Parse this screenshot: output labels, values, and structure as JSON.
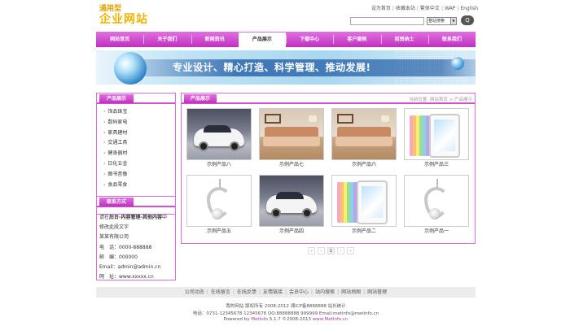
{
  "logo": {
    "line1": "通用型",
    "line2": "企业网站"
  },
  "toplinks": [
    "设为首页",
    "收藏本站",
    "繁体中文",
    "WAP",
    "English"
  ],
  "search": {
    "value": "",
    "select": "整站搜索",
    "button": "Q"
  },
  "nav": [
    "网站首页",
    "关于我们",
    "新闻资讯",
    "产品展示",
    "下载中心",
    "客户案例",
    "招贤纳士",
    "联系我们"
  ],
  "nav_active": "产品展示",
  "banner": {
    "slogan": "专业设计、精心打造、科学管理、推动发展!"
  },
  "sidebar": {
    "categories_title": "产品展示",
    "categories": [
      "饰品珠宝",
      "数码家电",
      "家具建材",
      "交通工具",
      "健身器材",
      "日化五金",
      "图书音像",
      "食品零食"
    ],
    "contact_title": "联系方式",
    "contact": {
      "line1_pre": "请在",
      "line1_bold": "后台-内容管理-其他内容",
      "line1_post": "中",
      "line2": "修改此段文字",
      "company": "某某有限公司",
      "phone": "电　话：0000-888888",
      "fax": "邮　编：000000",
      "email": "Email：admin@admin.cn",
      "web": "网　址：www.xxxxx.cn"
    }
  },
  "main": {
    "title": "产品展示",
    "breadcrumb": "当前位置: 网站首页 > 产品展示",
    "products": [
      {
        "name": "示例产品八",
        "type": "car"
      },
      {
        "name": "示例产品七",
        "type": "sofa"
      },
      {
        "name": "示例产品六",
        "type": "sofa"
      },
      {
        "name": "示例产品三",
        "type": "ipad"
      },
      {
        "name": "示例产品五",
        "type": "pendant"
      },
      {
        "name": "示例产品四",
        "type": "car"
      },
      {
        "name": "示例产品二",
        "type": "ipad"
      },
      {
        "name": "示例产品一",
        "type": "pendant"
      }
    ]
  },
  "pager": [
    "«",
    "‹",
    "1",
    "›",
    "»"
  ],
  "footer": {
    "links": [
      "公司动态",
      "在线留言",
      "在线反馈",
      "友情链接",
      "会员中心",
      "站内搜索",
      "网站地图",
      "网站管理"
    ],
    "copyright": "我的网站 版权所有 2008-2012 湘ICP备8888888 站长统计",
    "contact": "电话：0731-12345678 12345678 QQ:88888888 999999 Email:metinfo@metinfo.cn",
    "powered_pre": "Powered by ",
    "powered_link": "MetInfo",
    "powered_mid": " 5.1.7 ©2008-2013 ",
    "powered_site": "www.MetInfo.cn"
  },
  "colors": {
    "accent": "#c93cc9",
    "banner": "#a9d7ef"
  }
}
